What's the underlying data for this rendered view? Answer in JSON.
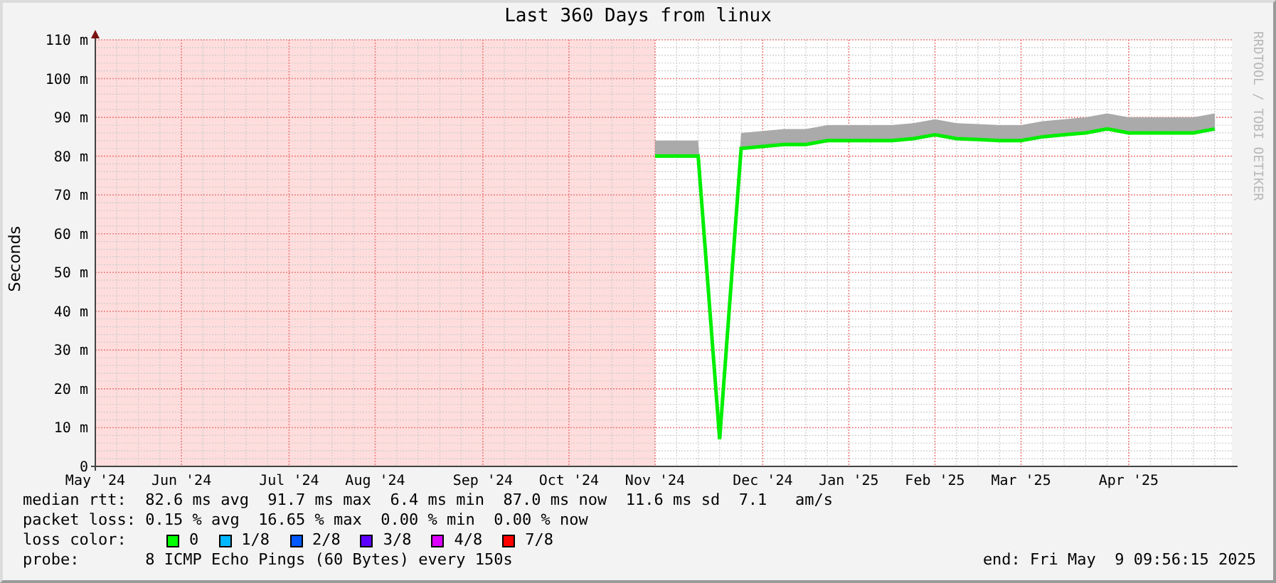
{
  "chart": {
    "chart_data": {
      "type": "line",
      "title": "Last 360 Days from linux",
      "ylabel": "Seconds",
      "categories": [
        "May '24",
        null,
        null,
        null,
        "Jun '24",
        null,
        null,
        null,
        null,
        "Jul '24",
        null,
        null,
        null,
        "Aug '24",
        null,
        null,
        null,
        null,
        "Sep '24",
        null,
        null,
        null,
        "Oct '24",
        null,
        null,
        null,
        "Nov '24",
        null,
        null,
        null,
        null,
        "Dec '24",
        null,
        null,
        null,
        "Jan '25",
        null,
        null,
        null,
        "Feb '25",
        null,
        null,
        null,
        "Mar '25",
        null,
        null,
        null,
        null,
        "Apr '25",
        null,
        null,
        null,
        null
      ],
      "grid": true,
      "series": [
        {
          "type": "area",
          "color": "#aaaaaa",
          "values": [
            null,
            null,
            null,
            null,
            null,
            null,
            null,
            null,
            null,
            null,
            null,
            null,
            null,
            null,
            null,
            null,
            null,
            null,
            null,
            null,
            null,
            null,
            null,
            null,
            null,
            null,
            84,
            84,
            84,
            10,
            86,
            86.5,
            87,
            87,
            88,
            88,
            88,
            88,
            88.5,
            89.5,
            88.5,
            88.3,
            88,
            88,
            89,
            89.5,
            90,
            91,
            90,
            90,
            90,
            90,
            91
          ]
        },
        {
          "type": "line",
          "color": "#00ee00",
          "values": [
            null,
            null,
            null,
            null,
            null,
            null,
            null,
            null,
            null,
            null,
            null,
            null,
            null,
            null,
            null,
            null,
            null,
            null,
            null,
            null,
            null,
            null,
            null,
            null,
            null,
            null,
            80,
            80,
            80,
            7,
            82,
            82.5,
            83,
            83,
            84,
            84,
            84,
            84,
            84.5,
            85.5,
            84.5,
            84.3,
            84,
            84,
            85,
            85.5,
            86,
            87,
            86,
            86,
            86,
            86,
            87
          ]
        }
      ],
      "ylim": [
        0,
        110
      ],
      "yticks": [
        {
          "value": 0,
          "label": "0"
        },
        {
          "value": 10,
          "label": "10 m"
        },
        {
          "value": 20,
          "label": "20 m"
        },
        {
          "value": 30,
          "label": "30 m"
        },
        {
          "value": 40,
          "label": "40 m"
        },
        {
          "value": 50,
          "label": "50 m"
        },
        {
          "value": 60,
          "label": "60 m"
        },
        {
          "value": 70,
          "label": "70 m"
        },
        {
          "value": 80,
          "label": "80 m"
        },
        {
          "value": 90,
          "label": "90 m"
        },
        {
          "value": 100,
          "label": "100 m"
        },
        {
          "value": 110,
          "label": "110 m"
        }
      ]
    },
    "watermark": "RRDTOOL / TOBI OETIKER"
  },
  "legend": {
    "median_rtt": "median rtt:  82.6 ms avg  91.7 ms max  6.4 ms min  87.0 ms now  11.6 ms sd  7.1   am/s",
    "packet_loss": "packet loss: 0.15 % avg  16.65 % max  0.00 % min  0.00 % now",
    "loss_color_label": "loss color:",
    "loss_colors": [
      {
        "label": "0",
        "color": "#00ff00"
      },
      {
        "label": "1/8",
        "color": "#00b8ff"
      },
      {
        "label": "2/8",
        "color": "#0059ff"
      },
      {
        "label": "3/8",
        "color": "#5e00ff"
      },
      {
        "label": "4/8",
        "color": "#dd00ff"
      },
      {
        "label": "7/8",
        "color": "#ff0000"
      }
    ],
    "probe": "probe:       8 ICMP Echo Pings (60 Bytes) every 150s",
    "end": "end: Fri May  9 09:56:15 2025"
  }
}
